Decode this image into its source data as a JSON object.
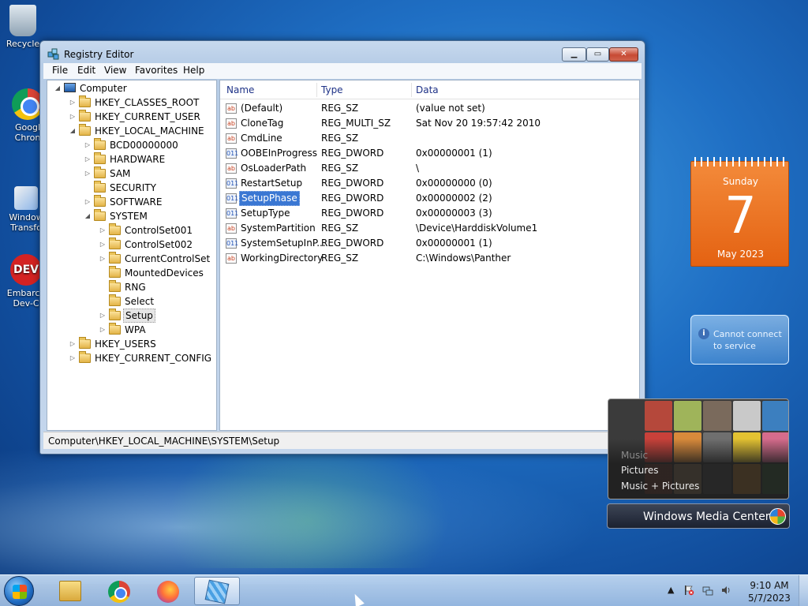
{
  "desktop": {
    "icons": [
      {
        "label": "Recycle"
      },
      {
        "label": "Googl Chron"
      },
      {
        "label": "Window Transfo"
      },
      {
        "label": "Embarca Dev-C"
      }
    ]
  },
  "window": {
    "title": "Registry Editor",
    "menu": [
      "File",
      "Edit",
      "View",
      "Favorites",
      "Help"
    ],
    "status_path": "Computer\\HKEY_LOCAL_MACHINE\\SYSTEM\\Setup"
  },
  "tree": [
    {
      "label": "Computer",
      "icon": "computer-icon",
      "expander": "expanded"
    },
    {
      "label": "HKEY_CLASSES_ROOT",
      "icon": "folder-icon",
      "expander": "collapsed"
    },
    {
      "label": "HKEY_CURRENT_USER",
      "icon": "folder-icon",
      "expander": "collapsed"
    },
    {
      "label": "HKEY_LOCAL_MACHINE",
      "icon": "folder-icon",
      "expander": "expanded"
    },
    {
      "label": "BCD00000000",
      "icon": "folder-icon",
      "expander": "collapsed"
    },
    {
      "label": "HARDWARE",
      "icon": "folder-icon",
      "expander": "collapsed"
    },
    {
      "label": "SAM",
      "icon": "folder-icon",
      "expander": "collapsed"
    },
    {
      "label": "SECURITY",
      "icon": "folder-icon",
      "expander": "none"
    },
    {
      "label": "SOFTWARE",
      "icon": "folder-icon",
      "expander": "collapsed"
    },
    {
      "label": "SYSTEM",
      "icon": "folder-icon",
      "expander": "expanded"
    },
    {
      "label": "ControlSet001",
      "icon": "folder-icon",
      "expander": "collapsed"
    },
    {
      "label": "ControlSet002",
      "icon": "folder-icon",
      "expander": "collapsed"
    },
    {
      "label": "CurrentControlSet",
      "icon": "folder-icon",
      "expander": "collapsed"
    },
    {
      "label": "MountedDevices",
      "icon": "folder-icon",
      "expander": "none"
    },
    {
      "label": "RNG",
      "icon": "folder-icon",
      "expander": "none"
    },
    {
      "label": "Select",
      "icon": "folder-icon",
      "expander": "none"
    },
    {
      "label": "Setup",
      "icon": "folder-icon",
      "expander": "collapsed",
      "selected": true
    },
    {
      "label": "WPA",
      "icon": "folder-icon",
      "expander": "collapsed"
    },
    {
      "label": "HKEY_USERS",
      "icon": "folder-icon",
      "expander": "collapsed"
    },
    {
      "label": "HKEY_CURRENT_CONFIG",
      "icon": "folder-icon",
      "expander": "collapsed"
    }
  ],
  "list": {
    "columns": [
      "Name",
      "Type",
      "Data"
    ],
    "rows": [
      {
        "name": "(Default)",
        "type": "REG_SZ",
        "data": "(value not set)",
        "icon": "string-value-icon"
      },
      {
        "name": "CloneTag",
        "type": "REG_MULTI_SZ",
        "data": "Sat Nov 20 19:57:42 2010",
        "icon": "string-value-icon"
      },
      {
        "name": "CmdLine",
        "type": "REG_SZ",
        "data": "",
        "icon": "string-value-icon"
      },
      {
        "name": "OOBEInProgress",
        "type": "REG_DWORD",
        "data": "0x00000001 (1)",
        "icon": "binary-value-icon"
      },
      {
        "name": "OsLoaderPath",
        "type": "REG_SZ",
        "data": "\\",
        "icon": "string-value-icon"
      },
      {
        "name": "RestartSetup",
        "type": "REG_DWORD",
        "data": "0x00000000 (0)",
        "icon": "binary-value-icon"
      },
      {
        "name": "SetupPhase",
        "type": "REG_DWORD",
        "data": "0x00000002 (2)",
        "icon": "binary-value-icon",
        "selected": true
      },
      {
        "name": "SetupType",
        "type": "REG_DWORD",
        "data": "0x00000003 (3)",
        "icon": "binary-value-icon"
      },
      {
        "name": "SystemPartition",
        "type": "REG_SZ",
        "data": "\\Device\\HarddiskVolume1",
        "icon": "string-value-icon"
      },
      {
        "name": "SystemSetupInP...",
        "type": "REG_DWORD",
        "data": "0x00000001 (1)",
        "icon": "binary-value-icon"
      },
      {
        "name": "WorkingDirectory",
        "type": "REG_SZ",
        "data": "C:\\Windows\\Panther",
        "icon": "string-value-icon"
      }
    ]
  },
  "calendar": {
    "weekday": "Sunday",
    "day": "7",
    "month_year": "May 2023"
  },
  "info_gadget": {
    "message": "Cannot connect to service"
  },
  "media_center": {
    "menu": [
      "Music",
      "Pictures",
      "Music + Pictures"
    ],
    "brand": "Windows Media Center"
  },
  "taskbar": {
    "time": "9:10 AM",
    "date": "5/7/2023"
  }
}
